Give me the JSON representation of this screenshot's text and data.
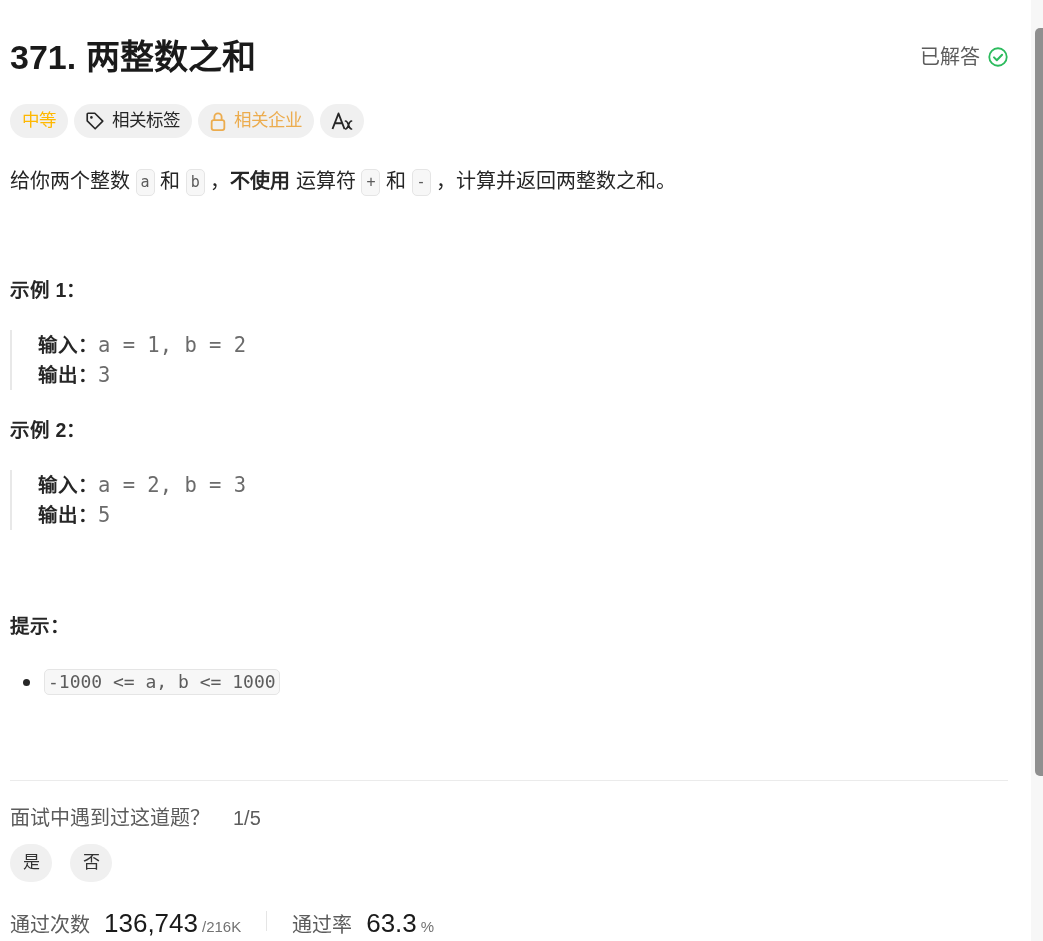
{
  "problem": {
    "title": "371. 两整数之和",
    "status": {
      "text": "已解答",
      "solved": true
    }
  },
  "tags": [
    {
      "kind": "difficulty",
      "label": "中等"
    },
    {
      "kind": "topics",
      "label": "相关标签"
    },
    {
      "kind": "companies",
      "label": "相关企业"
    },
    {
      "kind": "translate"
    }
  ],
  "description": [
    {
      "kind": "text",
      "text": "给你两个整数 "
    },
    {
      "kind": "code",
      "text": "a"
    },
    {
      "kind": "text",
      "text": " 和 "
    },
    {
      "kind": "code",
      "text": "b"
    },
    {
      "kind": "text",
      "text": " ，**不使用** 运算符 "
    },
    {
      "kind": "code",
      "text": "+"
    },
    {
      "kind": "text",
      "text": " 和 "
    },
    {
      "kind": "code",
      "text": "-"
    },
    {
      "kind": "text",
      "text": " ，计算并返回两整数之和。"
    }
  ],
  "examples": [
    {
      "heading": "示例 1：",
      "lines": [
        {
          "label": "输入：",
          "value": "a = 1, b = 2"
        },
        {
          "label": "输出：",
          "value": "3"
        }
      ]
    },
    {
      "heading": "示例 2：",
      "lines": [
        {
          "label": "输入：",
          "value": "a = 2, b = 3"
        },
        {
          "label": "输出：",
          "value": "5"
        }
      ]
    }
  ],
  "hints": {
    "heading": "提示：",
    "items": [
      "-1000 <= a, b <= 1000"
    ]
  },
  "interview": {
    "question": "面试中遇到过这道题？",
    "count": "1/5",
    "options": [
      "是",
      "否"
    ]
  },
  "stats": [
    {
      "label": "通过次数",
      "value": "136,743",
      "suffix": "/216K"
    },
    {
      "label": "通过率",
      "value": "63.3",
      "suffix": "%"
    }
  ]
}
